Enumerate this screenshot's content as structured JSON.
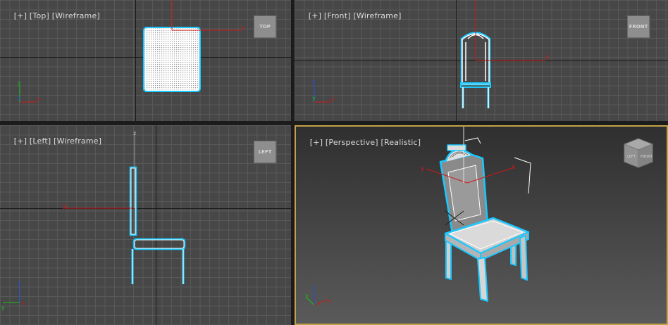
{
  "viewports": {
    "top": {
      "label_plus": "[+]",
      "label_view": "[Top]",
      "label_mode": "[Wireframe]",
      "nav_label": "TOP"
    },
    "front": {
      "label_plus": "[+]",
      "label_view": "[Front]",
      "label_mode": "[Wireframe]",
      "nav_label": "FRONT"
    },
    "left": {
      "label_plus": "[+]",
      "label_view": "[Left]",
      "label_mode": "[Wireframe]",
      "nav_label": "LEFT"
    },
    "perspective": {
      "label_plus": "[+]",
      "label_view": "[Perspective]",
      "label_mode": "[Realistic]",
      "nav_left": "LEFT",
      "nav_front": "FRONT"
    }
  },
  "axes": {
    "x": "x",
    "y": "y",
    "z": "z"
  },
  "colors": {
    "selection": "#19c8ff",
    "gizmo_x": "#d01818",
    "gizmo_y": "#18c018",
    "gizmo_z": "#2050e0",
    "active_border": "#c4a24a"
  }
}
